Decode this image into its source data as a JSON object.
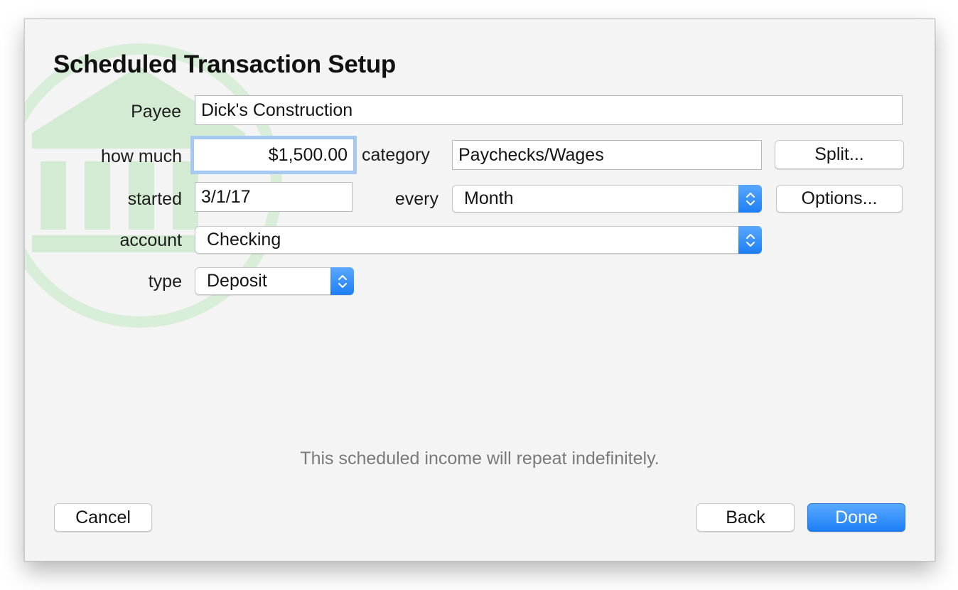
{
  "dialog": {
    "title": "Scheduled Transaction Setup"
  },
  "form": {
    "payee": {
      "label": "Payee",
      "value": "Dick's Construction"
    },
    "amount": {
      "label": "how much",
      "value": "$1,500.00"
    },
    "category": {
      "label": "category",
      "value": "Paychecks/Wages"
    },
    "split_button": "Split...",
    "started": {
      "label": "started",
      "value": "3/1/17"
    },
    "every": {
      "label": "every",
      "selected": "Month"
    },
    "options_button": "Options...",
    "account": {
      "label": "account",
      "selected": "Checking"
    },
    "type": {
      "label": "type",
      "selected": "Deposit"
    }
  },
  "note": "This scheduled income will repeat indefinitely.",
  "buttons": {
    "cancel": "Cancel",
    "back": "Back",
    "done": "Done"
  },
  "colors": {
    "accent": "#1c7ff6",
    "watermark": "#d6ecd6",
    "background": "#f4f4f4"
  },
  "icons": {
    "watermark": "bank-icon",
    "stepper": "up-down-chevron-icon"
  }
}
